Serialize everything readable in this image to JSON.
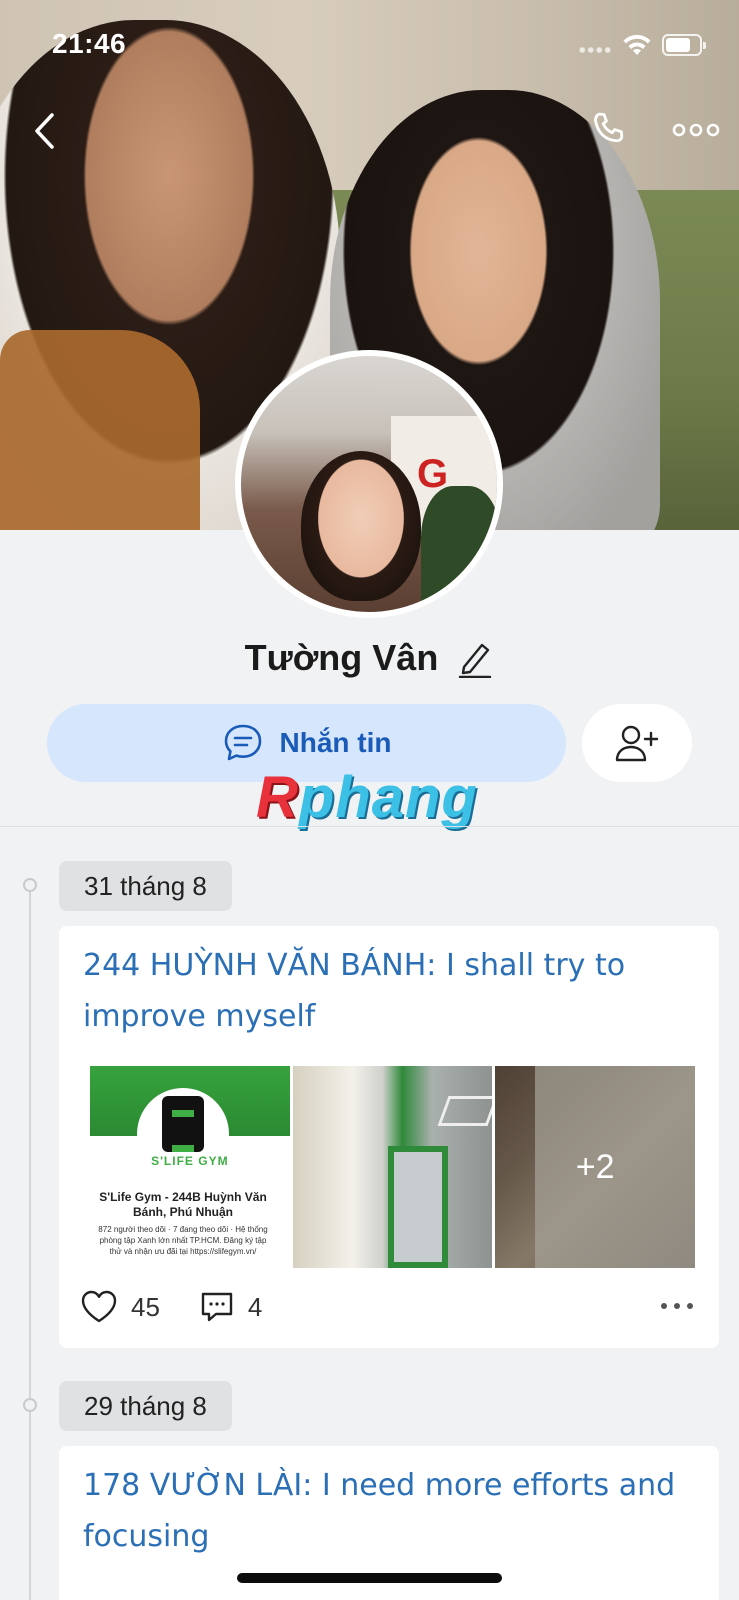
{
  "status_bar": {
    "time": "21:46"
  },
  "header": {
    "back_icon": "chevron-left-icon",
    "call_icon": "phone-icon",
    "more_icon": "more-horizontal-icon"
  },
  "profile": {
    "name": "Tường Vân",
    "edit_icon": "pencil-icon",
    "message_button_label": "Nhắn tin",
    "message_icon": "chat-bubble-icon",
    "add_friend_icon": "add-friend-icon"
  },
  "watermark": {
    "r": "R",
    "rest": "phang"
  },
  "colors": {
    "accent": "#1b5bb8",
    "title_link": "#2b6fb6",
    "message_bg": "#d5e6fd"
  },
  "timeline": [
    {
      "date": "31 tháng 8",
      "title": "244 HUỲNH VĂN BÁNH: I shall try to improve myself",
      "photo1": {
        "brand": "S'LIFE GYM",
        "name": "S'Life Gym - 244B Huỳnh Văn Bánh, Phú Nhuận",
        "meta": "872 người theo dõi · 7 đang theo dõi · Hệ thống phòng tập Xanh lớn nhất TP.HCM. Đăng ký tập thử và nhận ưu đãi tại https://slifegym.vn/"
      },
      "more_photos": "+2",
      "likes": "45",
      "comments": "4"
    },
    {
      "date": "29 tháng 8",
      "title": "178 VƯỜN LÀI: I need more efforts and focusing"
    }
  ]
}
